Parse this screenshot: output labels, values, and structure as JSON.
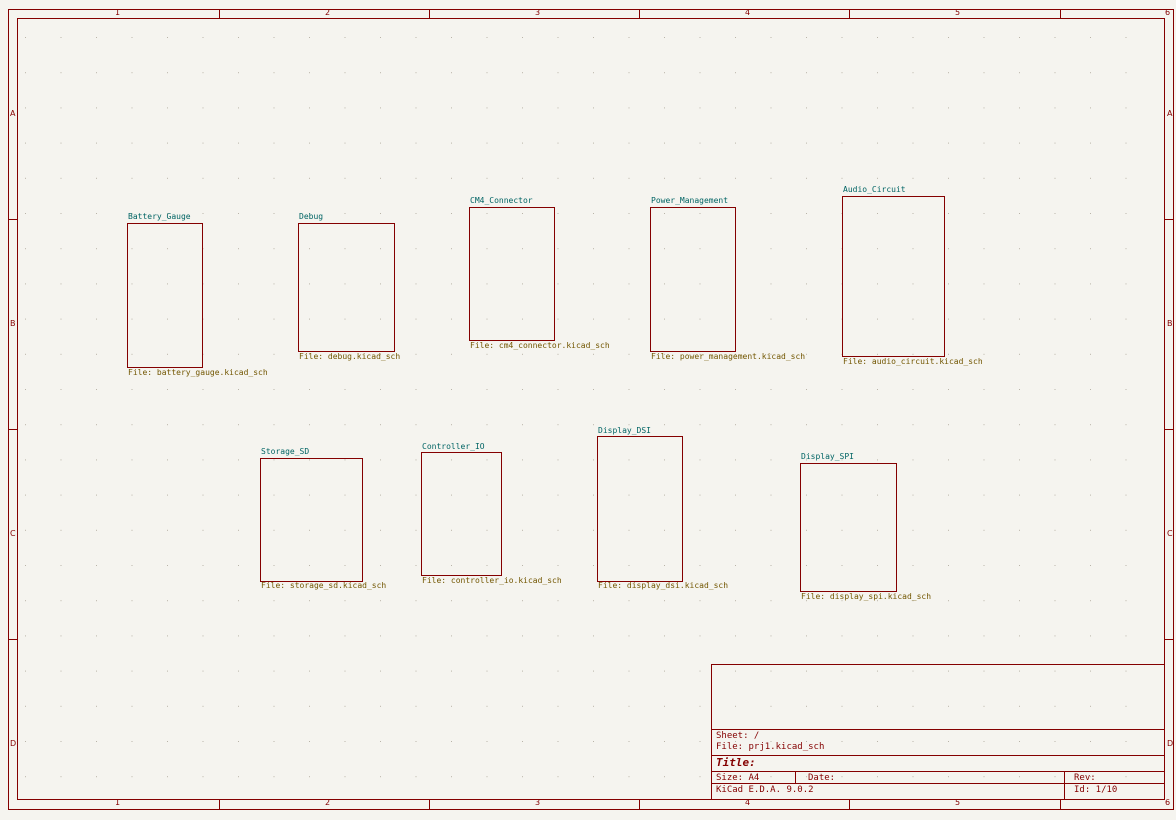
{
  "colors": {
    "background": "#f5f4ef",
    "border": "#840000",
    "sheet_name": "#006464",
    "sheet_file": "#725600",
    "grid_dot": "#b9b4a8"
  },
  "ruler": {
    "columns": [
      "1",
      "2",
      "3",
      "4",
      "5",
      "6"
    ],
    "rows": [
      "A",
      "B",
      "C",
      "D"
    ]
  },
  "sheets": [
    {
      "name": "Battery_Gauge",
      "file": "File: battery_gauge.kicad_sch"
    },
    {
      "name": "Debug",
      "file": "File: debug.kicad_sch"
    },
    {
      "name": "CM4_Connector",
      "file": "File: cm4_connector.kicad_sch"
    },
    {
      "name": "Power_Management",
      "file": "File: power_management.kicad_sch"
    },
    {
      "name": "Audio_Circuit",
      "file": "File: audio_circuit.kicad_sch"
    },
    {
      "name": "Storage_SD",
      "file": "File: storage_sd.kicad_sch"
    },
    {
      "name": "Controller_IO",
      "file": "File: controller_io.kicad_sch"
    },
    {
      "name": "Display_DSI",
      "file": "File: display_dsi.kicad_sch"
    },
    {
      "name": "Display_SPI",
      "file": "File: display_spi.kicad_sch"
    }
  ],
  "title_block": {
    "sheet": "Sheet: /",
    "file": "File: prj1.kicad_sch",
    "title": "Title:",
    "size": "Size: A4",
    "date": "Date:",
    "rev": "Rev:",
    "tool": "KiCad E.D.A. 9.0.2",
    "id": "Id: 1/10"
  }
}
